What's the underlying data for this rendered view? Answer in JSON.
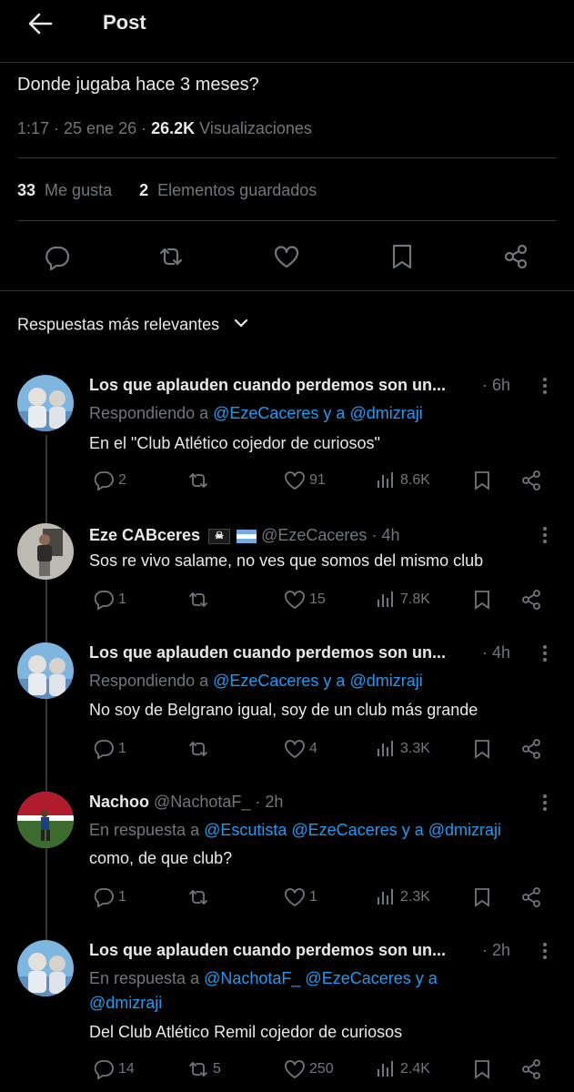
{
  "header": {
    "title": "Post"
  },
  "post": {
    "text": "Donde jugaba hace 3 meses?",
    "time": "1:17 · 25 ene 26 · ",
    "views_count": "26.2K",
    "views_label": " Visualizaciones",
    "likes_count": "33",
    "likes_label": "Me gusta",
    "saves_count": "2",
    "saves_label": "Elementos guardados"
  },
  "sort": {
    "label": "Respuestas más relevantes"
  },
  "replies": [
    {
      "name": "Los que aplauden cuando perdemos son un...",
      "handle": "",
      "time": "· 6h",
      "reply_prefix": "Respondiendo a ",
      "reply_links": "@EzeCaceres y a @dmizraji",
      "text": "En el \"Club Atlético cojedor de curiosos\"",
      "replies": "2",
      "reposts": "",
      "likes": "91",
      "views": "8.6K"
    },
    {
      "name": "Eze CABceres",
      "handle": "@EzeCaceres",
      "time": "· 4h",
      "text": "Sos re vivo salame, no ves que somos del mismo club",
      "replies": "1",
      "reposts": "",
      "likes": "15",
      "views": "7.8K"
    },
    {
      "name": "Los que aplauden cuando perdemos son un...",
      "time": "· 4h",
      "reply_prefix": "Respondiendo a ",
      "reply_links": "@EzeCaceres y a @dmizraji",
      "text": "No soy de Belgrano igual, soy de un club más grande",
      "replies": "1",
      "reposts": "",
      "likes": "4",
      "views": "3.3K"
    },
    {
      "name": "Nachoo",
      "handle": "@NachotaF_",
      "time": "· 2h",
      "reply_prefix": "En respuesta a ",
      "reply_links": "@Escutista @EzeCaceres y a @dmizraji",
      "text": "como, de que club?",
      "replies": "1",
      "reposts": "",
      "likes": "1",
      "views": "2.3K"
    },
    {
      "name": "Los que aplauden cuando perdemos son un...",
      "time": "· 2h",
      "reply_prefix": "En respuesta a ",
      "reply_links": "@NachotaF_ @EzeCaceres y a",
      "reply_links2": "@dmizraji",
      "text": "Del Club Atlético Remil cojedor de curiosos",
      "replies": "14",
      "reposts": "5",
      "likes": "250",
      "views": "2.4K"
    }
  ],
  "colors": {
    "background": "#000000",
    "text": "#e7e9ea",
    "muted": "#71767b",
    "link": "#1d9bf0",
    "divider": "#2f3336"
  },
  "icons": [
    "back-arrow-icon",
    "reply-icon",
    "repost-icon",
    "like-icon",
    "bookmark-icon",
    "share-icon",
    "chevron-down-icon",
    "more-icon",
    "views-icon",
    "pirate-flag-icon",
    "argentina-flag-icon"
  ]
}
